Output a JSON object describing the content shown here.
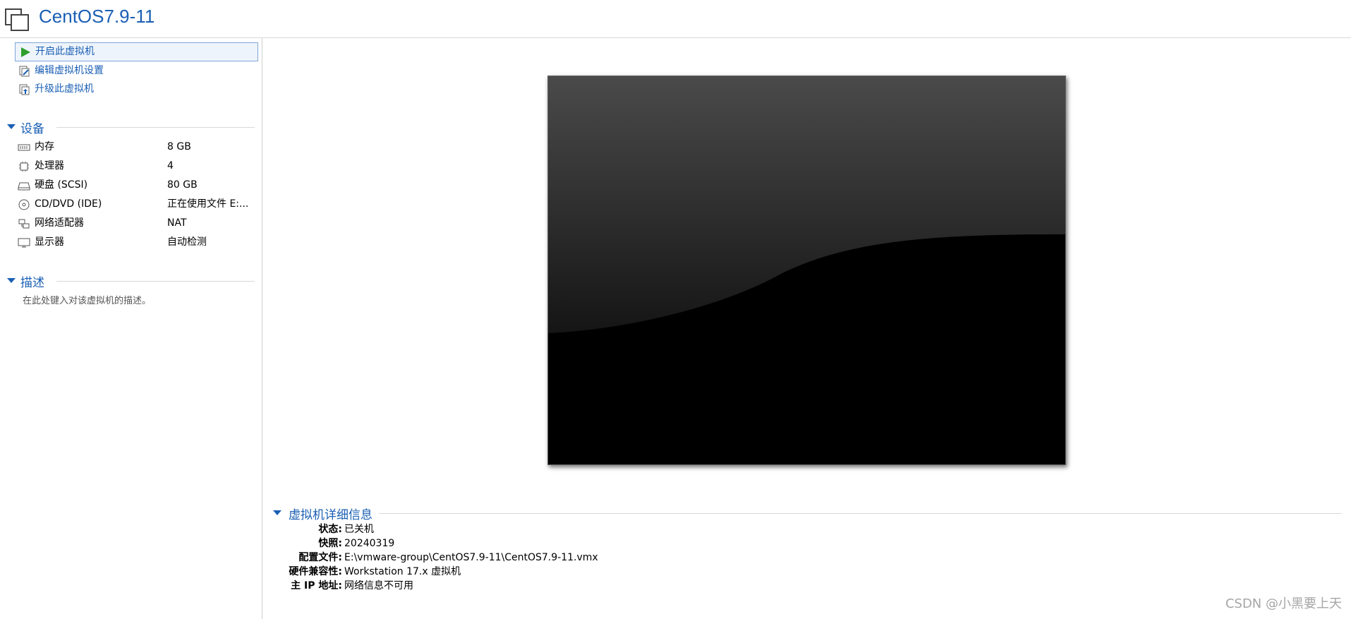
{
  "title": "CentOS7.9-11",
  "actions": [
    {
      "label": "开启此虚拟机",
      "icon": "play-icon"
    },
    {
      "label": "编辑虚拟机设置",
      "icon": "edit-settings-icon"
    },
    {
      "label": "升级此虚拟机",
      "icon": "upgrade-icon"
    }
  ],
  "devices": {
    "header": "设备",
    "items": [
      {
        "name": "内存",
        "value": "8 GB",
        "icon": "memory-icon"
      },
      {
        "name": "处理器",
        "value": "4",
        "icon": "cpu-icon"
      },
      {
        "name": "硬盘 (SCSI)",
        "value": "80 GB",
        "icon": "harddisk-icon"
      },
      {
        "name": "CD/DVD (IDE)",
        "value": "正在使用文件 E:...",
        "icon": "cd-dvd-icon"
      },
      {
        "name": "网络适配器",
        "value": "NAT",
        "icon": "network-adapter-icon"
      },
      {
        "name": "显示器",
        "value": "自动检测",
        "icon": "display-icon"
      }
    ]
  },
  "description": {
    "header": "描述",
    "placeholder": "在此处键入对该虚拟机的描述。"
  },
  "details": {
    "header": "虚拟机详细信息",
    "rows": [
      {
        "key": "状态:",
        "value": "已关机"
      },
      {
        "key": "快照:",
        "value": "20240319"
      },
      {
        "key": "配置文件:",
        "value": "E:\\vmware-group\\CentOS7.9-11\\CentOS7.9-11.vmx"
      },
      {
        "key": "硬件兼容性:",
        "value": "Workstation 17.x 虚拟机"
      },
      {
        "key": "主 IP 地址:",
        "value": "网络信息不可用"
      }
    ]
  },
  "watermark": "CSDN @小黑要上天",
  "colors": {
    "accent": "#1a5fb4",
    "play": "#2e9e2e"
  }
}
